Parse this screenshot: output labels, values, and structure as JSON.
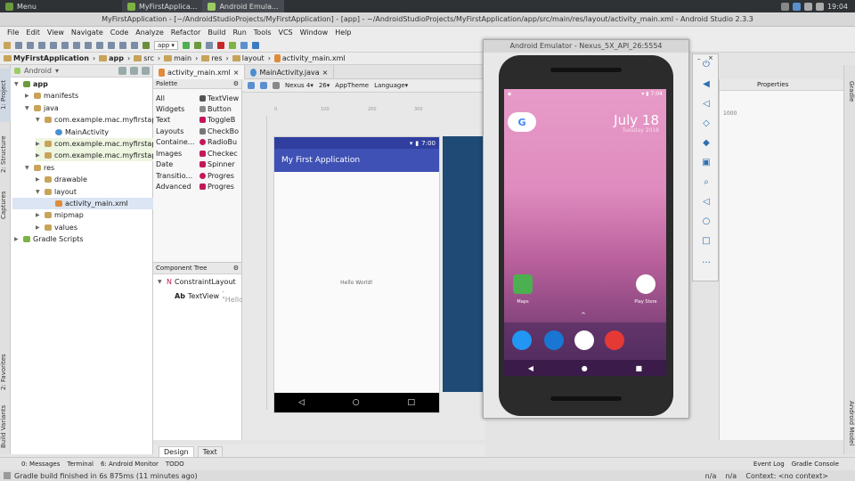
{
  "taskbar": {
    "menu": "Menu",
    "apps": [
      {
        "label": "MyFirstApplica..."
      },
      {
        "label": "Android Emula..."
      }
    ],
    "clock": "19:04"
  },
  "window_title": "MyFirstApplication - [~/AndroidStudioProjects/MyFirstApplication] - [app] - ~/AndroidStudioProjects/MyFirstApplication/app/src/main/res/layout/activity_main.xml - Android Studio 2.3.3",
  "menu": [
    "File",
    "Edit",
    "View",
    "Navigate",
    "Code",
    "Analyze",
    "Refactor",
    "Build",
    "Run",
    "Tools",
    "VCS",
    "Window",
    "Help"
  ],
  "toolbar": {
    "run_config": "app"
  },
  "breadcrumb": [
    "MyFirstApplication",
    "app",
    "src",
    "main",
    "res",
    "layout",
    "activity_main.xml"
  ],
  "left_strip": {
    "project": "1: Project",
    "structure": "2: Structure",
    "captures": "Captures",
    "favorites": "2: Favorites",
    "build_variants": "Build Variants"
  },
  "project": {
    "view": "Android",
    "items": [
      {
        "label": "app",
        "level": 0,
        "kind": "module"
      },
      {
        "label": "manifests",
        "level": 1,
        "kind": "folder"
      },
      {
        "label": "java",
        "level": 1,
        "kind": "folder"
      },
      {
        "label": "com.example.mac.myfirstapplic",
        "level": 2,
        "kind": "package"
      },
      {
        "label": "MainActivity",
        "level": 3,
        "kind": "class"
      },
      {
        "label": "com.example.mac.myfirstapplic",
        "level": 2,
        "kind": "package"
      },
      {
        "label": "com.example.mac.myfirstapplic",
        "level": 2,
        "kind": "package"
      },
      {
        "label": "res",
        "level": 1,
        "kind": "folder"
      },
      {
        "label": "drawable",
        "level": 2,
        "kind": "folder"
      },
      {
        "label": "layout",
        "level": 2,
        "kind": "folder"
      },
      {
        "label": "activity_main.xml",
        "level": 3,
        "kind": "xml"
      },
      {
        "label": "mipmap",
        "level": 2,
        "kind": "folder"
      },
      {
        "label": "values",
        "level": 2,
        "kind": "folder"
      },
      {
        "label": "Gradle Scripts",
        "level": 0,
        "kind": "gradle"
      }
    ]
  },
  "editor_tabs": [
    {
      "label": "activity_main.xml",
      "active": true
    },
    {
      "label": "MainActivity.java",
      "active": false
    }
  ],
  "palette": {
    "title": "Palette",
    "categories": [
      "All",
      "Widgets",
      "Text",
      "Layouts",
      "Containe...",
      "Images",
      "Date",
      "Transitio...",
      "Advanced"
    ],
    "widgets": [
      "TextView",
      "Button",
      "ToggleB",
      "CheckBo",
      "RadioBu",
      "Checkec",
      "Spinner",
      "Progres",
      "Progres"
    ]
  },
  "component_tree": {
    "title": "Component Tree",
    "root": "ConstraintLayout",
    "child": "TextView",
    "child_text": "- \"Hello"
  },
  "design_toolbar": {
    "device": "Nexus 4",
    "api": "26",
    "theme": "AppTheme",
    "language": "Language"
  },
  "ruler": [
    "0",
    "100",
    "200",
    "300"
  ],
  "preview": {
    "time": "7:00",
    "app_title": "My First Application",
    "content": "Hello World!"
  },
  "bottom_tabs": [
    {
      "label": "Design",
      "active": true
    },
    {
      "label": "Text",
      "active": false
    }
  ],
  "emulator": {
    "title": "Android Emulator - Nexus_5X_API_26:5554",
    "time": "7:04",
    "date": "July 18",
    "date_sub": "Tuesday 2018",
    "apps": [
      {
        "label": "Maps"
      },
      {
        "label": "Play Store"
      }
    ]
  },
  "properties": {
    "title": "Properties",
    "value": "1000"
  },
  "right_strip": {
    "gradle": "Gradle",
    "model": "Android Model"
  },
  "tool_windows": {
    "left": [
      "0: Messages",
      "Terminal",
      "6: Android Monitor",
      "TODO"
    ],
    "right": [
      "Event Log",
      "Gradle Console"
    ]
  },
  "status": {
    "message": "Gradle build finished in 6s 875ms (11 minutes ago)",
    "right": "n/a    n/a    Context: <no context>"
  }
}
